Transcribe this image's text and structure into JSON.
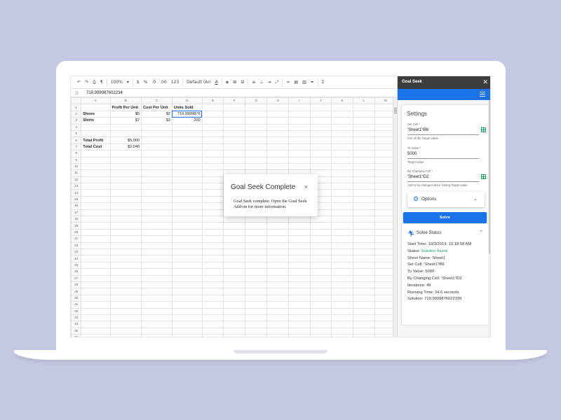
{
  "toolbar": {
    "zoom": "100%",
    "currency": "$",
    "percent": "%",
    "decimal_less": ".0",
    "decimal_more": ".00",
    "format_more": "123",
    "font": "Default (Ari",
    "text_color_icon": "A"
  },
  "formula_bar": {
    "fx": "fx",
    "value": "719.999987602234"
  },
  "sheet": {
    "columns": [
      "A",
      "B",
      "C",
      "D",
      "E",
      "F",
      "G",
      "H",
      "I",
      "J",
      "K",
      "L",
      "M"
    ],
    "rows": [
      [
        "",
        "Profit Per Unit",
        "Cost Per Unit",
        "Units Sold"
      ],
      [
        "Shoes",
        "$5",
        "$2",
        "719.9999876"
      ],
      [
        "Shirts",
        "$7",
        "$3",
        "200"
      ],
      [
        "",
        "",
        "",
        ""
      ],
      [
        "",
        "",
        "",
        ""
      ],
      [
        "Total Profit",
        "$5,000",
        "",
        ""
      ],
      [
        "Total Cost",
        "$2,040",
        "",
        ""
      ]
    ],
    "row_count": 37
  },
  "dialog": {
    "title": "Goal Seek Complete",
    "close": "×",
    "body": "Goal Seek complete. Open the Goal Seek Add-on for more information."
  },
  "panel": {
    "title": "Goal Seek",
    "close": "✕",
    "settings": {
      "heading": "Settings",
      "set_cell_label": "Set Cell *",
      "set_cell_value": "'Sheet1'!B6",
      "set_cell_hint": "Cell of the Target value",
      "to_value_label": "To Value *",
      "to_value_value": "5000",
      "to_value_hint": "Target value",
      "changing_label": "By Changing Cell *",
      "changing_value": "'Sheet1'!D2",
      "changing_hint": "Cell to be changed when finding Target value"
    },
    "options_label": "Options",
    "solve_label": "Solve",
    "status": {
      "heading": "Solve Status",
      "start_time": "Start Time: 10/3/2019, 10:18:58 AM",
      "status_prefix": "Status: ",
      "status_value": "Solution found",
      "sheet_name": "Sheet Name: Sheet1",
      "set_cell": "Set Cell: 'Sheet1'!B6",
      "to_value": "To Value: 5000",
      "changing_cell": "By Changing Cell: 'Sheet1'!D2",
      "iterations": "Iterations: 49",
      "running_time": "Running Time: 34.6 seconds",
      "solution": "Solution: 719.9999876022339"
    }
  },
  "colors": {
    "background": "#c5c8e3",
    "accent": "#1a73e8",
    "success": "#0f9d58",
    "panel_header": "#3c3c3c"
  }
}
